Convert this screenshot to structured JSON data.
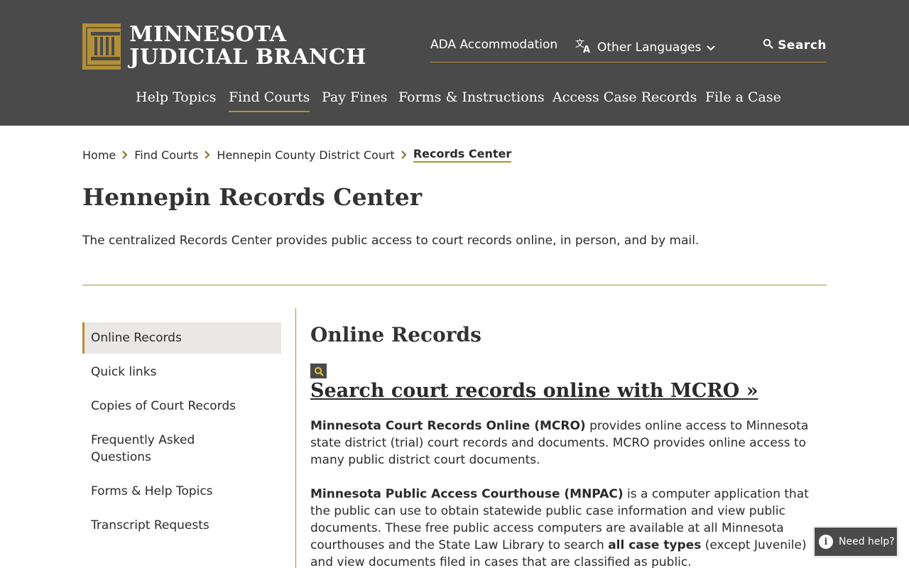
{
  "header": {
    "logo_line1": "MINNESOTA",
    "logo_line2": "JUDICIAL BRANCH",
    "ada_label": "ADA Accommodation",
    "languages_label": "Other Languages",
    "search_label": "Search",
    "nav": [
      "Help Topics",
      "Find Courts",
      "Pay Fines",
      "Forms & Instructions",
      "Access Case Records",
      "File a Case"
    ],
    "active_nav": "Find Courts"
  },
  "breadcrumb": {
    "items": [
      "Home",
      "Find Courts",
      "Hennepin County District Court"
    ],
    "current": "Records Center"
  },
  "page": {
    "title": "Hennepin Records Center",
    "intro": "The centralized Records Center provides public access to court records online, in person, and by mail."
  },
  "sidebar": {
    "items": [
      {
        "label": "Online Records"
      },
      {
        "label": "Quick links"
      },
      {
        "label": "Copies of Court Records"
      },
      {
        "label": "Frequently Asked Questions"
      },
      {
        "label": "Forms & Help Topics"
      },
      {
        "label": "Transcript Requests"
      }
    ],
    "active": "Online Records"
  },
  "main": {
    "heading": "Online Records",
    "cta": "Search court records online with MCRO »",
    "p1_bold": "Minnesota Court Records Online (MCRO)",
    "p1_rest": " provides online access to Minnesota state district (trial) court records and documents. MCRO provides online access to many public district court documents.",
    "p2_bold": "Minnesota Public Access Courthouse (MNPAC)",
    "p2_rest": " is a computer application that the public can use to obtain statewide public case information and view public documents. These free public access computers are available at all Minnesota courthouses and the State Law Library to search ",
    "p2_bold2": "all case types",
    "p2_rest2": " (except Juvenile) and view documents filed in cases that are classified as public."
  },
  "help_widget": {
    "label": "Need help?"
  },
  "colors": {
    "header_bg": "#4a4a4a",
    "accent_gold": "#b39036",
    "sidebar_active_bg": "#e9e8e6"
  }
}
